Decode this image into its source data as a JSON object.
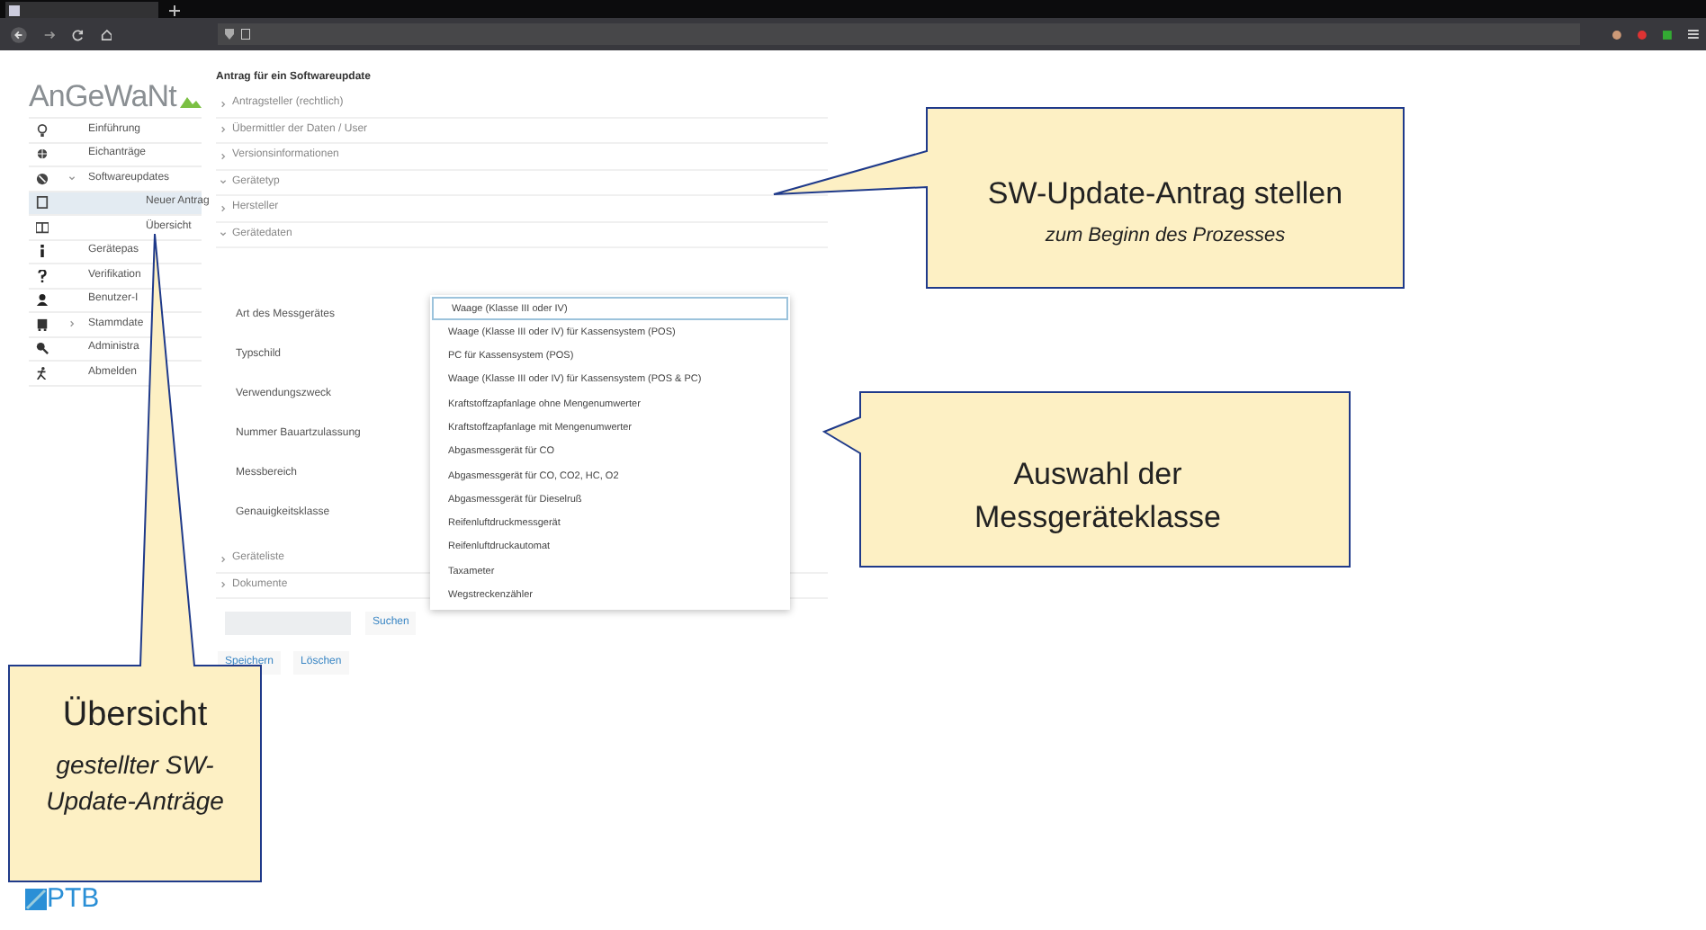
{
  "app": {
    "logo": "AnGeWaNt"
  },
  "sidebar": {
    "items": [
      {
        "label": "Einführung",
        "selected": false
      },
      {
        "label": "Eichanträge",
        "selected": false
      },
      {
        "label": "Softwareupdates",
        "selected": false,
        "expanded": true,
        "children": [
          {
            "label": "Neuer Antrag",
            "selected": true
          },
          {
            "label": "Übersicht",
            "selected": false
          }
        ]
      },
      {
        "label": "Gerätepas",
        "selected": false
      },
      {
        "label": "Verifikation",
        "selected": false
      },
      {
        "label": "Benutzer-I",
        "selected": false
      },
      {
        "label": "Stammdate",
        "selected": false,
        "expanded": false
      },
      {
        "label": "Administra",
        "selected": false
      },
      {
        "label": "Abmelden",
        "selected": false
      }
    ]
  },
  "form": {
    "title": "Antrag für ein Softwareupdate",
    "sections": [
      {
        "label": "Antragsteller (rechtlich)",
        "expanded": false
      },
      {
        "label": "Übermittler der Daten / User",
        "expanded": false
      },
      {
        "label": "Versionsinformationen",
        "expanded": false
      },
      {
        "label": "Gerätetyp",
        "expanded": true
      },
      {
        "label": "Hersteller",
        "expanded": false
      },
      {
        "label": "Gerätedaten",
        "expanded": true
      }
    ],
    "fields": [
      "Art des Messgerätes",
      "Typschild",
      "Verwendungszweck",
      "Nummer Bauartzulassung",
      "Messbereich",
      "Genauigkeitsklasse"
    ],
    "more_sections": [
      {
        "label": "Geräteliste",
        "expanded": false
      },
      {
        "label": "Dokumente",
        "expanded": false
      }
    ],
    "search_button": "Suchen",
    "buttons": [
      "Speichern",
      "Löschen"
    ]
  },
  "dropdown": {
    "options": [
      {
        "label": "Waage (Klasse III oder IV)",
        "selected": true
      },
      {
        "label": "Waage (Klasse III oder IV) für Kassensystem (POS)",
        "selected": false
      },
      {
        "label": "PC für Kassensystem (POS)",
        "selected": false
      },
      {
        "label": "Waage (Klasse III oder IV) für Kassensystem (POS & PC)",
        "selected": false
      },
      {
        "label": "Kraftstoffzapfanlage ohne Mengenumwerter",
        "selected": false
      },
      {
        "label": "Kraftstoffzapfanlage mit Mengenumwerter",
        "selected": false
      },
      {
        "label": "Abgasmessgerät für CO",
        "selected": false
      },
      {
        "label": "Abgasmessgerät für CO, CO2, HC, O2",
        "selected": false
      },
      {
        "label": "Abgasmessgerät für Dieselruß",
        "selected": false
      },
      {
        "label": "Reifenluftdruckmessgerät",
        "selected": false
      },
      {
        "label": "Reifenluftdruckautomat",
        "selected": false
      },
      {
        "label": "Taxameter",
        "selected": false
      },
      {
        "label": "Wegstreckenzähler",
        "selected": false
      }
    ]
  },
  "callouts": [
    {
      "title": "SW-Update-Antrag stellen",
      "subtitle": "zum Beginn des Prozesses"
    },
    {
      "title": "Auswahl der Messgeräteklasse"
    },
    {
      "title": "Übersicht",
      "subtitle": "gestellter SW-Update-Anträge"
    }
  ],
  "footer": {
    "logo": "PTB"
  }
}
